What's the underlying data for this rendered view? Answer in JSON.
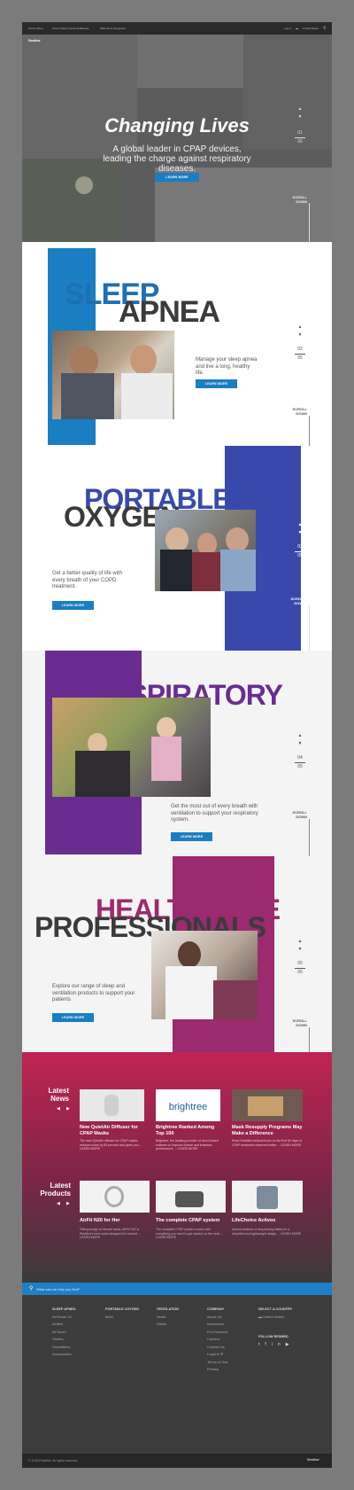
{
  "nav": {
    "items": [
      "Find & Shop",
      "Find a Sleep Doctor",
      "Healthcare",
      "Patients & Caregivers"
    ],
    "login": "Log In",
    "region": "United States",
    "logo": "ResMed"
  },
  "hero": {
    "title": "Changing Lives",
    "subtitle": "A global leader in CPAP devices, leading the charge against respiratory diseases.",
    "button": "LEARN MORE",
    "page": "01",
    "total": "05",
    "scroll": "SCROLL DOWN"
  },
  "sleep": {
    "word1": "SLEEP",
    "word2": "APNEA",
    "text": "Manage your sleep apnea and live a long, healthy life.",
    "button": "LEARN MORE",
    "page": "02",
    "total": "05",
    "scroll": "SCROLL DOWN",
    "color": "#1a7ec2"
  },
  "oxygen": {
    "word1": "PORTABLE",
    "word2": "OXYGEN",
    "text": "Get a better quality of life with every breath of your COPD treatment.",
    "button": "LEARN MORE",
    "page": "03",
    "total": "05",
    "scroll": "SCROLL DOWN",
    "color": "#3949ab"
  },
  "respiratory": {
    "word1": "RESPIRATORY",
    "text": "Get the most out of every breath with ventilation to support your respiratory system.",
    "button": "LEARN MORE",
    "page": "04",
    "total": "05",
    "scroll": "SCROLL DOWN",
    "color": "#6a2c91"
  },
  "healthcare": {
    "word1": "HEALTHCARE",
    "word2": "PROFESSIONALS",
    "text": "Explore our range of sleep and ventilation products to support your patients",
    "button": "LEARN MORE",
    "page": "05",
    "total": "05",
    "scroll": "SCROLL DOWN",
    "color": "#9b2a6e"
  },
  "news": {
    "heading1": "Latest",
    "heading2": "News",
    "items": [
      {
        "title": "New QuietAir Diffuser for CPAP Masks",
        "text": "The new QuietAir diffuser for CPAP masks reduces noise by 83 percent and gives you ... LEARN MORE"
      },
      {
        "title": "Brightree Ranked Among Top 100",
        "text": "Brightree, the leading provider of cloud-based software to improve clinical and business performance ... LEARN MORE",
        "logo": "brightree"
      },
      {
        "title": "Mask Resupply Programs May Make a Difference",
        "text": "Read ResMed medical focus on the first 90 days of CPAP treatment observed better ... LEARN MORE"
      }
    ]
  },
  "products": {
    "heading1": "Latest",
    "heading2": "Products",
    "items": [
      {
        "title": "AirFit N20 for Her",
        "text": "Fitting snugly on female faces, AirFit N20 is ResMed's best mask designed for comfort ... LEARN MORE"
      },
      {
        "title": "The complete CPAP system",
        "text": "The complete CPAP system comes with everything you need to get started on the most ... LEARN MORE"
      },
      {
        "title": "LifeChoice Activox",
        "text": "Activox features a long-lasting battery in a simplified and lightweight design ... LEARN MORE"
      }
    ]
  },
  "search": {
    "placeholder": "What can we help you find?"
  },
  "footer": {
    "cols": [
      {
        "head": "SLEEP APNEA",
        "items": [
          "AirSense 10",
          "AirMini",
          "AirTouch",
          "Stories",
          "Humidifiers",
          "Accessories"
        ]
      },
      {
        "head": "PORTABLE OXYGEN",
        "items": [
          "Mobi"
        ]
      },
      {
        "head": "VENTILATION",
        "items": [
          "Astral",
          "Stellar"
        ]
      },
      {
        "head": "COMPANY",
        "items": [
          "About Us",
          "Newsroom",
          "For Investors",
          "Careers",
          "Contact Us",
          "Legal & IP",
          "Terms of Use",
          "Privacy"
        ]
      },
      {
        "head": "SELECT A COUNTRY",
        "items": [
          "United States"
        ]
      }
    ],
    "follow": "FOLLOW RESMED",
    "copyright": "© 2018 ResMed. All rights reserved.",
    "logo": "ResMed"
  }
}
